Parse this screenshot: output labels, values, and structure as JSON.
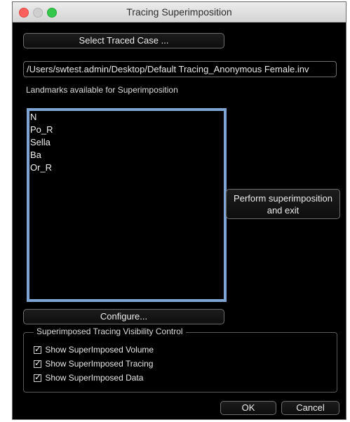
{
  "window": {
    "title": "Tracing Superimposition"
  },
  "buttons": {
    "select_traced_case": "Select Traced Case ...",
    "perform_superimposition": [
      "Perform superimposition",
      "and exit"
    ],
    "configure": "Configure...",
    "ok": "OK",
    "cancel": "Cancel"
  },
  "file_path": "/Users/swtest.admin/Desktop/Default Tracing_Anonymous Female.inv",
  "landmarks": {
    "label": "Landmarks available for Superimposition",
    "items": [
      "N",
      "Po_R",
      "Sella",
      "Ba",
      "Or_R"
    ]
  },
  "visibility_control": {
    "title": "Superimposed Tracing Visibility Control",
    "options": [
      {
        "label": "Show SuperImposed Volume",
        "checked": true
      },
      {
        "label": "Show SuperImposed Tracing",
        "checked": true
      },
      {
        "label": "Show SuperImposed Data",
        "checked": true
      }
    ]
  },
  "colors": {
    "background": "#000000",
    "list_border_accent": "#7ea4d3",
    "close": "#fc605c",
    "maximize": "#34c84a"
  }
}
